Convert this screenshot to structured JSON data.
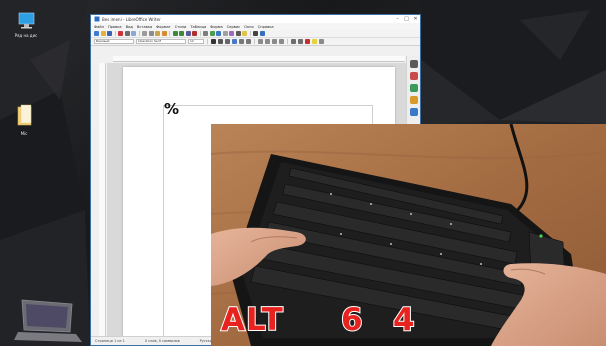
{
  "desktop": {
    "icons": [
      {
        "name": "recycle-bin-icon",
        "label": "Ряд на дис"
      },
      {
        "name": "folder-icon",
        "label": "Mic"
      }
    ]
  },
  "window": {
    "title": "Bes imeni - LibreOffice Writer",
    "menu": [
      "Файл",
      "Правка",
      "Вид",
      "Вставка",
      "Формат",
      "Стили",
      "Таблица",
      "Форма",
      "Сервис",
      "Окно",
      "Справка"
    ],
    "paragraph_style": "Базовый",
    "font_name": "Liberation Serif",
    "font_size": "12",
    "page_text": "%",
    "status": {
      "page": "Страница 1 из 1",
      "words": "0 слов, 0 символов",
      "language": "Русский"
    }
  },
  "overlay": {
    "key1": "ALT",
    "key2": "6",
    "key3": "4"
  },
  "colors": {
    "overlay_text": "#e8231f",
    "overlay_stroke": "#ffffff",
    "table_surface": "#a8714a",
    "window_border": "#3a6ea5"
  }
}
